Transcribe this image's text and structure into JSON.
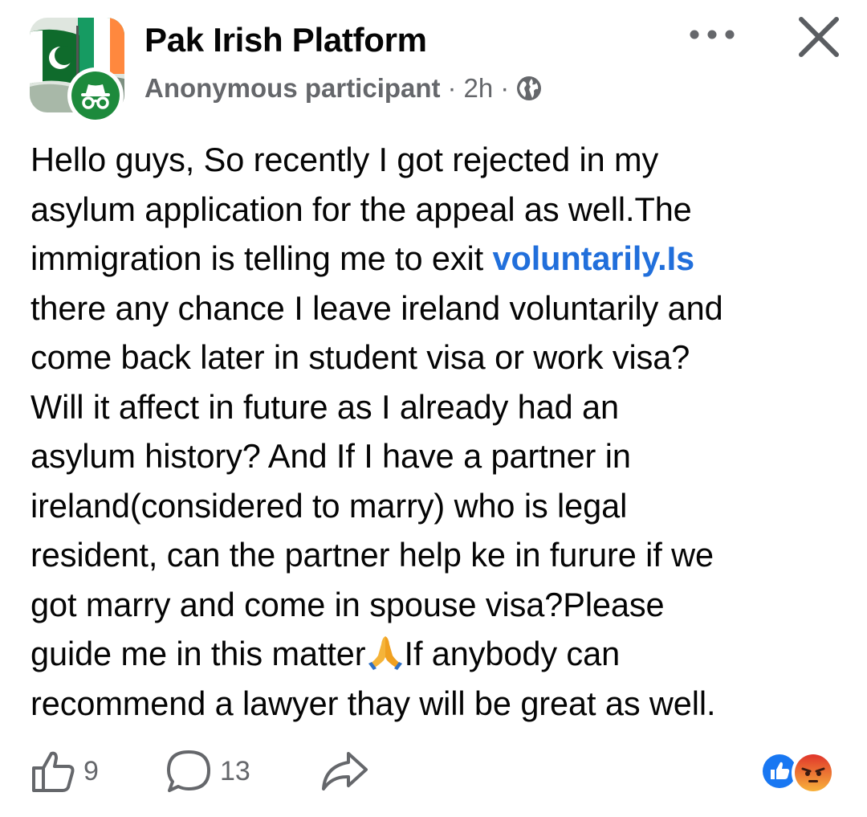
{
  "group": {
    "name": "Pak Irish Platform",
    "avatar_icon": "pakistan-ireland-flags-avatar",
    "badge_icon": "anonymous-incognito-icon"
  },
  "post_meta": {
    "author": "Anonymous participant",
    "separator": "·",
    "time": "2h",
    "audience_icon": "globe-icon"
  },
  "header_actions": {
    "more_icon": "more-dots-icon",
    "close_icon": "close-icon"
  },
  "post_lines": {
    "l1": "Hello guys, So recently I got rejected in my",
    "l2": "asylum application for the appeal as well.The",
    "l3a": "immigration is telling me to exit ",
    "l3_link": "voluntarily.Is",
    "l4": "there any chance I leave ireland voluntarily and",
    "l5": "come back later in student visa or work visa?",
    "l6": "Will it affect in future as I already had an",
    "l7": "asylum history? And If I have a partner in",
    "l8": "ireland(considered to marry) who is legal",
    "l9": "resident, can the partner help ke in furure if we",
    "l10": "got marry and come in spouse visa?Please",
    "l11a": "guide me in this matter",
    "l11_emoji": "folded-hands-emoji",
    "l11b": "If anybody can",
    "l12": "recommend a lawyer thay will be great as well."
  },
  "footer": {
    "like_count": "9",
    "comment_count": "13",
    "like_icon": "thumbs-up-icon",
    "comment_icon": "comment-bubble-icon",
    "share_icon": "share-arrow-icon",
    "reactions": [
      "like-reaction-icon",
      "angry-reaction-icon"
    ]
  },
  "colors": {
    "link": "#216fdb",
    "secondary_text": "#65676b",
    "anon_badge": "#1d8a3c",
    "like_blue": "#1877f2",
    "angry_orange": "#f0592a"
  }
}
